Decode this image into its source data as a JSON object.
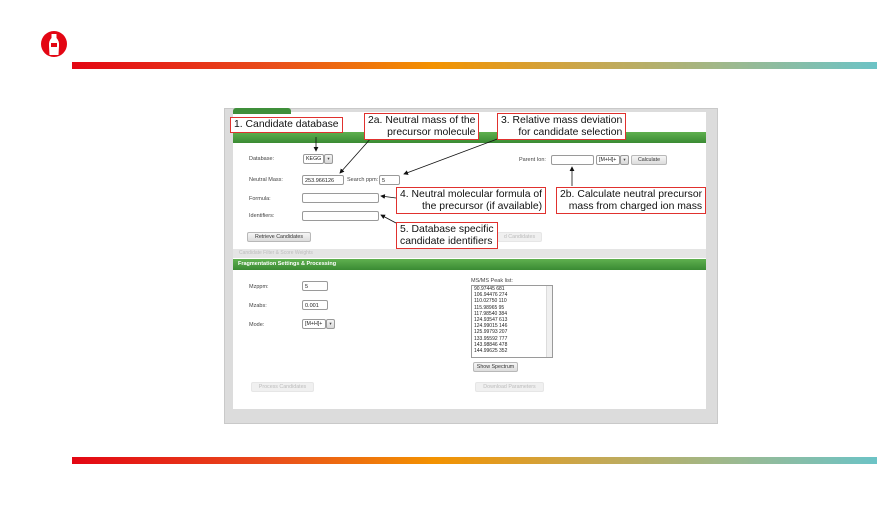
{
  "colors": {
    "accent_red": "#e30613",
    "green_header": "#3f8f3a",
    "callout_border": "#e0312e"
  },
  "logo": {
    "icon": "bottle-logo-icon"
  },
  "form": {
    "database_label": "Database:",
    "database_value": "KEGG",
    "parent_ion_label": "Parent Ion:",
    "parent_ion_value": "",
    "adduct_value": "[M+H]+",
    "calculate_label": "Calculate",
    "neutral_mass_label": "Neutral Mass:",
    "neutral_mass_value": "253.966126",
    "search_ppm_label": "Search ppm:",
    "search_ppm_value": "5",
    "formula_label": "Formula:",
    "formula_value": "",
    "identifiers_label": "Identifiers:",
    "identifiers_value": "",
    "retrieve_label": "Retrieve Candidates",
    "retrieve_right_label": "d Candidates"
  },
  "sections": {
    "candidate_filter": "Candidate Filter & Score Weights",
    "fragmentation": "Fragmentation Settings & Processing"
  },
  "frag": {
    "mzppm_label": "Mzppm:",
    "mzppm_value": "5",
    "mzabs_label": "Mzabs:",
    "mzabs_value": "0.001",
    "mode_label": "Mode:",
    "mode_value": "[M+H]+",
    "peaklist_label": "MS/MS Peak list:",
    "peaks": [
      "90.97445 681",
      "106.94476 274",
      "110.02750 110",
      "115.98965 95",
      "117.98540 384",
      "124.93547 613",
      "124.99015 146",
      "125.99793 207",
      "133.95592 777",
      "143.98846 478",
      "144.99625 352"
    ],
    "show_spectrum_label": "Show Spectrum",
    "process_label": "Process Candidates",
    "download_label": "Download Parameters"
  },
  "callouts": {
    "c1": "1. Candidate database",
    "c2a_1": "2a. Neutral mass of the",
    "c2a_2": "precursor molecule",
    "c3_1": "3. Relative mass deviation",
    "c3_2": "for candidate selection",
    "c4_1": "4. Neutral molecular formula of",
    "c4_2": "the precursor (if available)",
    "c2b_1": "2b. Calculate neutral precursor",
    "c2b_2": "mass from charged ion mass",
    "c5_1": "5. Database specific",
    "c5_2": "candidate identifiers"
  }
}
